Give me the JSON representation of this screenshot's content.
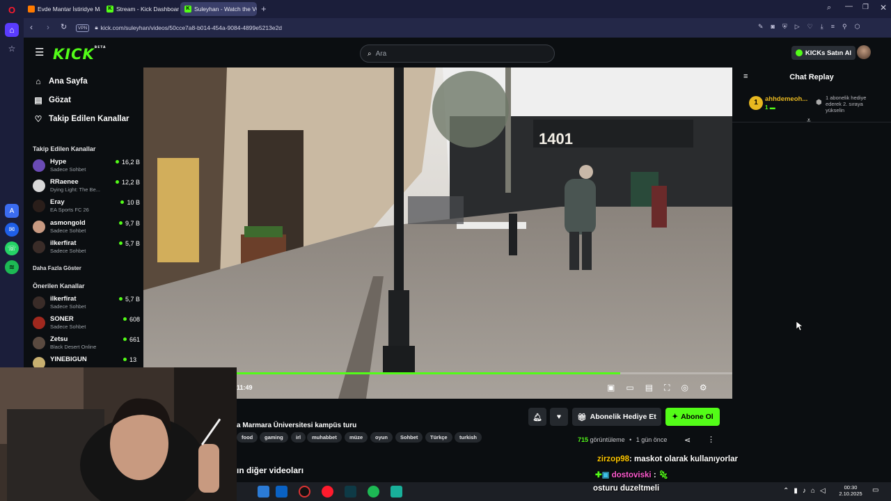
{
  "browser": {
    "tabs": [
      {
        "title": "Evde Mantar İstiridye Man",
        "active": false
      },
      {
        "title": "Stream - Kick Dashboard",
        "active": false
      },
      {
        "title": "Suleyhan - Watch the VOD",
        "active": true
      }
    ],
    "vpn_label": "VPN",
    "url": "kick.com/suleyhan/videos/50cce7a8-b014-454a-9084-4899e5213e2d"
  },
  "header": {
    "logo": "KICK",
    "logo_badge": "BETA",
    "search_placeholder": "Ara",
    "kicks_button": "KICKs Satın Al"
  },
  "sidebar": {
    "nav": [
      {
        "label": "Ana Sayfa",
        "icon": "home-icon"
      },
      {
        "label": "Gözat",
        "icon": "browse-icon"
      },
      {
        "label": "Takip Edilen Kanallar",
        "icon": "heart-icon"
      }
    ],
    "followed_title": "Takip Edilen Kanallar",
    "followed": [
      {
        "name": "Hype",
        "category": "Sadece Sohbet",
        "viewers": "16,2 B"
      },
      {
        "name": "RRaenee",
        "category": "Dying Light: The Be...",
        "viewers": "12,2 B"
      },
      {
        "name": "Eray",
        "category": "EA Sports FC 26",
        "viewers": "10 B"
      },
      {
        "name": "asmongold",
        "category": "Sadece Sohbet",
        "viewers": "9,7 B"
      },
      {
        "name": "ilkerfirat",
        "category": "Sadece Sohbet",
        "viewers": "5,7 B"
      }
    ],
    "show_more": "Daha Fazla Göster",
    "recommended_title": "Önerilen Kanallar",
    "recommended": [
      {
        "name": "ilkerfirat",
        "category": "Sadece Sohbet",
        "viewers": "5,7 B"
      },
      {
        "name": "SONER",
        "category": "Sadece Sohbet",
        "viewers": "608"
      },
      {
        "name": "Zetsu",
        "category": "Black Desert Online",
        "viewers": "661"
      },
      {
        "name": "YINEBIGUN",
        "category": "",
        "viewers": "131"
      }
    ]
  },
  "player": {
    "time": "11:49",
    "progress": 0.81
  },
  "video_info": {
    "title": "a Marmara Üniversitesi kampüs turu",
    "tags": [
      "food",
      "gaming",
      "irl",
      "muhabbet",
      "müze",
      "oyun",
      "Sohbet",
      "Türkçe",
      "turkish"
    ],
    "views": "715",
    "views_label": "görüntüleme",
    "age": "1 gün önce",
    "other_videos": "ın diğer videoları",
    "gift_sub_button": "Abonelik Hediye Et",
    "subscribe_button": "Abone Ol"
  },
  "chat": {
    "title": "Chat Replay",
    "pinned_user": "ahhdemeoh...",
    "pinned_rank": "1",
    "pinned_count": "1",
    "pinned_message": "1 abonelik hediye ederek 2. sıraya yükselin"
  },
  "stream_overlay": {
    "messages": [
      {
        "user": "zirzop98",
        "text": ": maskot olarak kullanıyorlar"
      },
      {
        "user": "dostoviski",
        "text": ":"
      },
      {
        "user": "",
        "text": "osturu duzeltmeli"
      }
    ]
  },
  "taskbar": {
    "time": "00:30",
    "date": "2.10.2025"
  },
  "colors": {
    "kick_green": "#53fc18",
    "background": "#0b0e11"
  }
}
